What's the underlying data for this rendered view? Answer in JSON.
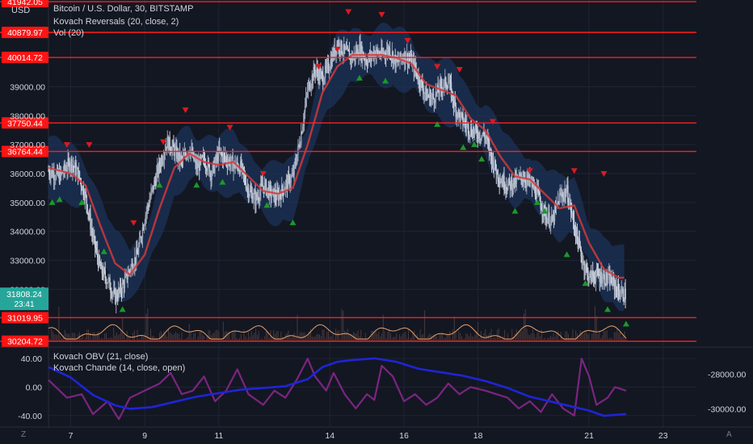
{
  "header": {
    "title": "Bitcoin / U.S. Dollar, 30, BITSTAMP",
    "currency": "USD",
    "overlay_1": "Kovach Reversals (20, close, 2)",
    "overlay_2": "Vol (20)"
  },
  "lower_pane": {
    "indicator_1": "Kovach OBV (21, close)",
    "indicator_2": "Kovach Chande (14, close, open)"
  },
  "footer": {
    "left_label": "Z",
    "right_label": "A"
  },
  "last_price": {
    "value": "31808.24",
    "countdown": "23:41"
  },
  "colors": {
    "background": "#131722",
    "grid": "#1f2433",
    "candle_up": "#9aa3b5",
    "candle_down": "#c9cfdb",
    "band_fill": "#1c3358",
    "ma": "#d23a3a",
    "level": "#ff1e1e",
    "label_bg": "#ff1414",
    "osc": "#7b2580",
    "obv": "#1e25d6",
    "sell": "#d81b22",
    "buy": "#1a9a2a",
    "volume_line": "#e8a06a",
    "last_price_bg": "#26a69a"
  },
  "chart_data": {
    "type": "candlestick",
    "price_axis": {
      "ylim": [
        30000,
        42000
      ],
      "ticks": [
        "39000.00",
        "38000.00",
        "37000.00",
        "36000.00",
        "35000.00",
        "34000.00",
        "33000.00",
        "32000.00"
      ],
      "tick_values": [
        39000,
        38000,
        37000,
        36000,
        35000,
        34000,
        33000,
        32000
      ]
    },
    "x_ticks": [
      "7",
      "9",
      "11",
      "14",
      "16",
      "18",
      "21",
      "23"
    ],
    "x_tick_days": [
      7,
      9,
      11,
      14,
      16,
      18,
      21,
      23
    ],
    "x_range_days": [
      6.4,
      23.9
    ],
    "levels": [
      41942.05,
      40879.97,
      40014.72,
      37750.44,
      36764.44,
      31019.95,
      30204.72
    ],
    "level_labels": [
      "41942.05",
      "40879.97",
      "40014.72",
      "37750.44",
      "36764.44",
      "31019.95",
      "30204.72"
    ],
    "price_path": [
      [
        6.4,
        36100
      ],
      [
        6.7,
        35900
      ],
      [
        7.0,
        36400
      ],
      [
        7.2,
        36000
      ],
      [
        7.4,
        35200
      ],
      [
        7.6,
        33800
      ],
      [
        7.8,
        32700
      ],
      [
        8.0,
        32300
      ],
      [
        8.2,
        31700
      ],
      [
        8.4,
        32100
      ],
      [
        8.6,
        32700
      ],
      [
        8.8,
        33200
      ],
      [
        9.0,
        34500
      ],
      [
        9.2,
        35400
      ],
      [
        9.4,
        36300
      ],
      [
        9.6,
        37100
      ],
      [
        9.8,
        36800
      ],
      [
        10.0,
        36400
      ],
      [
        10.2,
        36900
      ],
      [
        10.4,
        36200
      ],
      [
        10.6,
        36500
      ],
      [
        10.8,
        36000
      ],
      [
        11.0,
        36700
      ],
      [
        11.2,
        36500
      ],
      [
        11.4,
        36300
      ],
      [
        11.6,
        36200
      ],
      [
        11.8,
        35400
      ],
      [
        12.0,
        35100
      ],
      [
        12.2,
        35600
      ],
      [
        12.4,
        35300
      ],
      [
        12.6,
        35200
      ],
      [
        12.8,
        35600
      ],
      [
        13.0,
        35900
      ],
      [
        13.2,
        37200
      ],
      [
        13.4,
        38900
      ],
      [
        13.6,
        39600
      ],
      [
        13.8,
        39300
      ],
      [
        14.0,
        39800
      ],
      [
        14.2,
        40500
      ],
      [
        14.4,
        40200
      ],
      [
        14.6,
        40000
      ],
      [
        14.8,
        40300
      ],
      [
        15.0,
        39900
      ],
      [
        15.2,
        40200
      ],
      [
        15.4,
        40100
      ],
      [
        15.6,
        40300
      ],
      [
        15.8,
        39800
      ],
      [
        16.0,
        40100
      ],
      [
        16.2,
        39900
      ],
      [
        16.4,
        39300
      ],
      [
        16.6,
        38700
      ],
      [
        16.8,
        38600
      ],
      [
        17.0,
        39000
      ],
      [
        17.2,
        39200
      ],
      [
        17.4,
        38200
      ],
      [
        17.6,
        37800
      ],
      [
        17.8,
        37500
      ],
      [
        18.0,
        37400
      ],
      [
        18.2,
        37300
      ],
      [
        18.4,
        36400
      ],
      [
        18.6,
        35800
      ],
      [
        18.8,
        35600
      ],
      [
        19.0,
        35700
      ],
      [
        19.2,
        35900
      ],
      [
        19.4,
        35700
      ],
      [
        19.6,
        35300
      ],
      [
        19.8,
        34600
      ],
      [
        20.0,
        34300
      ],
      [
        20.2,
        35200
      ],
      [
        20.4,
        35400
      ],
      [
        20.6,
        34200
      ],
      [
        20.8,
        33100
      ],
      [
        21.0,
        32400
      ],
      [
        21.2,
        32500
      ],
      [
        21.4,
        32400
      ],
      [
        21.6,
        32300
      ],
      [
        21.8,
        31900
      ],
      [
        22.0,
        31800
      ]
    ],
    "ma_path": [
      [
        6.4,
        36200
      ],
      [
        7.0,
        36000
      ],
      [
        7.4,
        35600
      ],
      [
        7.8,
        34200
      ],
      [
        8.2,
        32900
      ],
      [
        8.6,
        32500
      ],
      [
        9.0,
        33200
      ],
      [
        9.4,
        34800
      ],
      [
        9.8,
        36200
      ],
      [
        10.2,
        36700
      ],
      [
        10.6,
        36400
      ],
      [
        11.0,
        36300
      ],
      [
        11.4,
        36400
      ],
      [
        11.8,
        35900
      ],
      [
        12.2,
        35400
      ],
      [
        12.6,
        35300
      ],
      [
        13.0,
        35500
      ],
      [
        13.4,
        37000
      ],
      [
        13.8,
        38800
      ],
      [
        14.2,
        39700
      ],
      [
        14.6,
        40100
      ],
      [
        15.0,
        40100
      ],
      [
        15.4,
        40100
      ],
      [
        15.8,
        40000
      ],
      [
        16.2,
        39800
      ],
      [
        16.6,
        39100
      ],
      [
        17.0,
        38900
      ],
      [
        17.4,
        38700
      ],
      [
        17.8,
        37900
      ],
      [
        18.2,
        37500
      ],
      [
        18.6,
        36600
      ],
      [
        19.0,
        35900
      ],
      [
        19.4,
        35800
      ],
      [
        19.8,
        35300
      ],
      [
        20.2,
        34800
      ],
      [
        20.6,
        34900
      ],
      [
        21.0,
        33600
      ],
      [
        21.4,
        32700
      ],
      [
        21.8,
        32400
      ],
      [
        22.0,
        32400
      ]
    ],
    "sell_markers": [
      [
        6.9,
        37000
      ],
      [
        7.5,
        37000
      ],
      [
        8.7,
        34300
      ],
      [
        9.5,
        37100
      ],
      [
        10.1,
        38200
      ],
      [
        11.3,
        37600
      ],
      [
        12.2,
        36000
      ],
      [
        13.7,
        39700
      ],
      [
        14.2,
        40300
      ],
      [
        14.5,
        41600
      ],
      [
        15.4,
        41500
      ],
      [
        16.1,
        40600
      ],
      [
        16.9,
        39700
      ],
      [
        17.5,
        39600
      ],
      [
        18.4,
        37800
      ],
      [
        19.4,
        36100
      ],
      [
        20.6,
        36100
      ],
      [
        21.4,
        36000
      ]
    ],
    "buy_markers": [
      [
        6.5,
        35000
      ],
      [
        6.7,
        35100
      ],
      [
        7.3,
        35000
      ],
      [
        7.9,
        33300
      ],
      [
        8.4,
        31300
      ],
      [
        9.4,
        35600
      ],
      [
        10.4,
        35600
      ],
      [
        11.1,
        35700
      ],
      [
        12.3,
        34900
      ],
      [
        13.0,
        34300
      ],
      [
        14.8,
        39300
      ],
      [
        15.5,
        39200
      ],
      [
        16.9,
        37700
      ],
      [
        17.6,
        36900
      ],
      [
        17.9,
        37000
      ],
      [
        18.1,
        36500
      ],
      [
        19.0,
        34700
      ],
      [
        19.6,
        35000
      ],
      [
        19.8,
        34700
      ],
      [
        20.4,
        33200
      ],
      [
        20.9,
        32200
      ],
      [
        21.5,
        31300
      ],
      [
        22.0,
        30800
      ]
    ],
    "oscillator": {
      "ylim": [
        -55,
        55
      ],
      "ticks": [
        "40.00",
        "0.00",
        "-40.00"
      ],
      "tick_values": [
        40,
        0,
        -40
      ],
      "secondary_ticks": [
        "-28000.00",
        "-30000.00"
      ],
      "secondary_values": [
        -28000,
        -30000
      ],
      "secondary_ylim": [
        -31000,
        -26500
      ],
      "chande_path": [
        [
          6.4,
          10
        ],
        [
          6.9,
          -15
        ],
        [
          7.3,
          -10
        ],
        [
          7.6,
          -38
        ],
        [
          8.0,
          -20
        ],
        [
          8.3,
          -45
        ],
        [
          8.6,
          -15
        ],
        [
          9.0,
          -5
        ],
        [
          9.4,
          5
        ],
        [
          9.7,
          20
        ],
        [
          10.0,
          -10
        ],
        [
          10.3,
          -5
        ],
        [
          10.6,
          15
        ],
        [
          10.9,
          -20
        ],
        [
          11.2,
          -5
        ],
        [
          11.5,
          25
        ],
        [
          11.8,
          -10
        ],
        [
          12.2,
          -25
        ],
        [
          12.5,
          -5
        ],
        [
          12.8,
          -15
        ],
        [
          13.1,
          10
        ],
        [
          13.4,
          40
        ],
        [
          13.6,
          15
        ],
        [
          13.9,
          -5
        ],
        [
          14.1,
          20
        ],
        [
          14.4,
          -10
        ],
        [
          14.7,
          -30
        ],
        [
          15.0,
          -10
        ],
        [
          15.2,
          -18
        ],
        [
          15.4,
          30
        ],
        [
          15.7,
          15
        ],
        [
          16.0,
          -20
        ],
        [
          16.3,
          -10
        ],
        [
          16.6,
          -25
        ],
        [
          16.9,
          -15
        ],
        [
          17.2,
          5
        ],
        [
          17.5,
          -10
        ],
        [
          17.8,
          0
        ],
        [
          18.2,
          -5
        ],
        [
          18.5,
          -10
        ],
        [
          18.8,
          -15
        ],
        [
          19.1,
          -30
        ],
        [
          19.4,
          -20
        ],
        [
          19.7,
          -35
        ],
        [
          20.0,
          -10
        ],
        [
          20.3,
          -30
        ],
        [
          20.6,
          -40
        ],
        [
          20.8,
          40
        ],
        [
          21.0,
          15
        ],
        [
          21.2,
          -25
        ],
        [
          21.5,
          -15
        ],
        [
          21.7,
          0
        ],
        [
          22.0,
          -5
        ]
      ],
      "obv_path": [
        [
          6.4,
          -27600
        ],
        [
          7.0,
          -28200
        ],
        [
          7.6,
          -29200
        ],
        [
          8.2,
          -29800
        ],
        [
          8.6,
          -30000
        ],
        [
          9.2,
          -29900
        ],
        [
          9.8,
          -29600
        ],
        [
          10.4,
          -29300
        ],
        [
          11.0,
          -29100
        ],
        [
          11.6,
          -28900
        ],
        [
          12.2,
          -28800
        ],
        [
          12.8,
          -28700
        ],
        [
          13.4,
          -28300
        ],
        [
          13.8,
          -27600
        ],
        [
          14.2,
          -27300
        ],
        [
          14.6,
          -27200
        ],
        [
          15.2,
          -27100
        ],
        [
          15.8,
          -27300
        ],
        [
          16.4,
          -27700
        ],
        [
          17.0,
          -27900
        ],
        [
          17.6,
          -28100
        ],
        [
          18.2,
          -28400
        ],
        [
          18.8,
          -28800
        ],
        [
          19.4,
          -29300
        ],
        [
          20.0,
          -29600
        ],
        [
          20.6,
          -29900
        ],
        [
          21.0,
          -30100
        ],
        [
          21.4,
          -30400
        ],
        [
          22.0,
          -30300
        ]
      ]
    }
  }
}
